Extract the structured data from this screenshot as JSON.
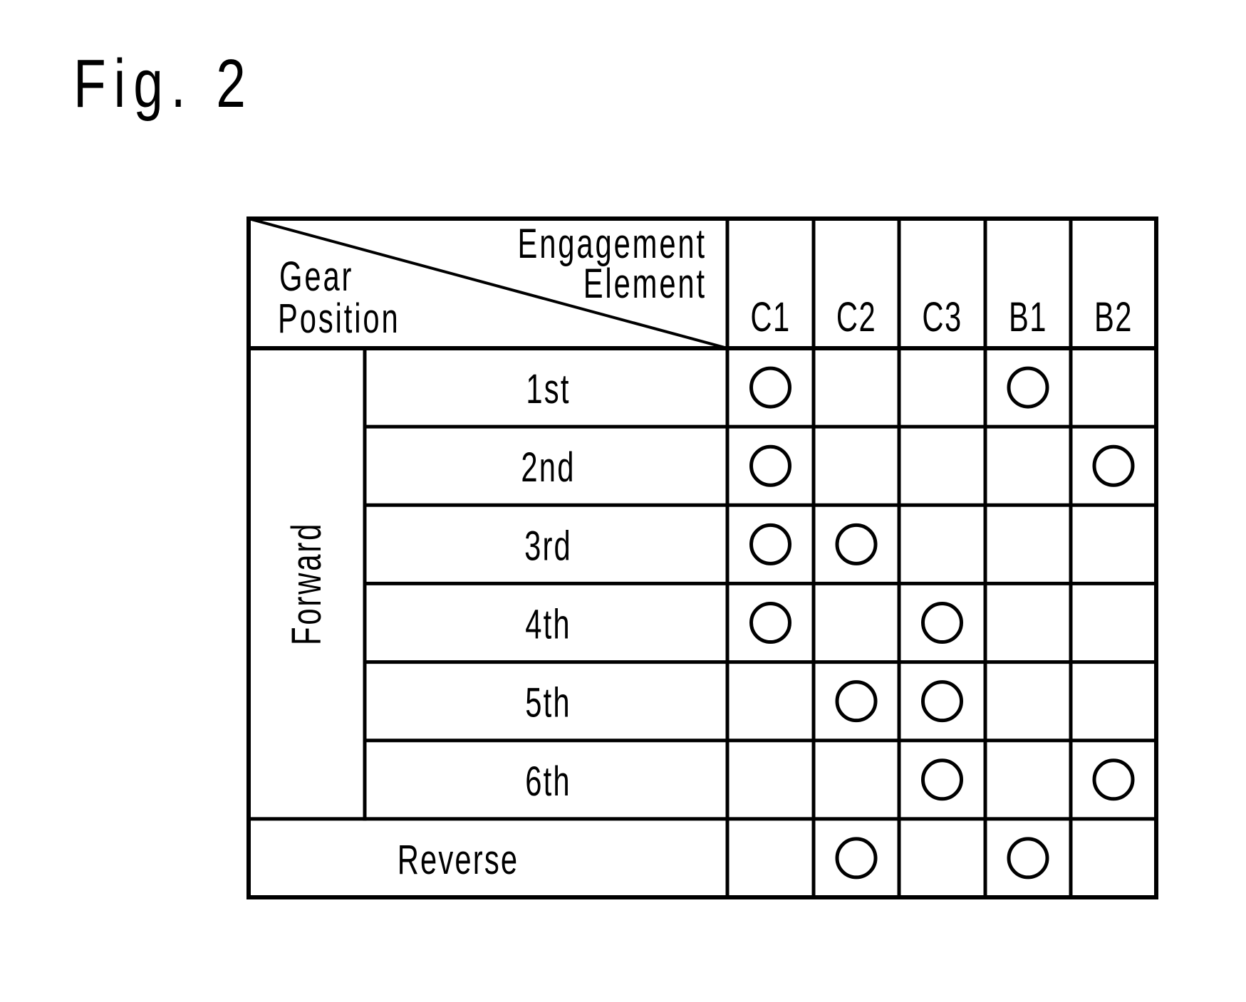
{
  "figure": {
    "title": "Fig. 2"
  },
  "table": {
    "corner_header": {
      "top_right_line1": "Engagement",
      "top_right_line2": "Element",
      "bottom_left_line1": "Gear",
      "bottom_left_line2": "Position"
    },
    "columns": [
      "C1",
      "C2",
      "C3",
      "B1",
      "B2"
    ],
    "group_label": "Forward",
    "rows": [
      {
        "label": "1st",
        "group": "Forward",
        "engaged": [
          "C1",
          "B1"
        ]
      },
      {
        "label": "2nd",
        "group": "Forward",
        "engaged": [
          "C1",
          "B2"
        ]
      },
      {
        "label": "3rd",
        "group": "Forward",
        "engaged": [
          "C1",
          "C2"
        ]
      },
      {
        "label": "4th",
        "group": "Forward",
        "engaged": [
          "C1",
          "C3"
        ]
      },
      {
        "label": "5th",
        "group": "Forward",
        "engaged": [
          "C2",
          "C3"
        ]
      },
      {
        "label": "6th",
        "group": "Forward",
        "engaged": [
          "C3",
          "B2"
        ]
      },
      {
        "label": "Reverse",
        "group": null,
        "engaged": [
          "C2",
          "B1"
        ]
      }
    ],
    "mark_symbol": "circle"
  }
}
